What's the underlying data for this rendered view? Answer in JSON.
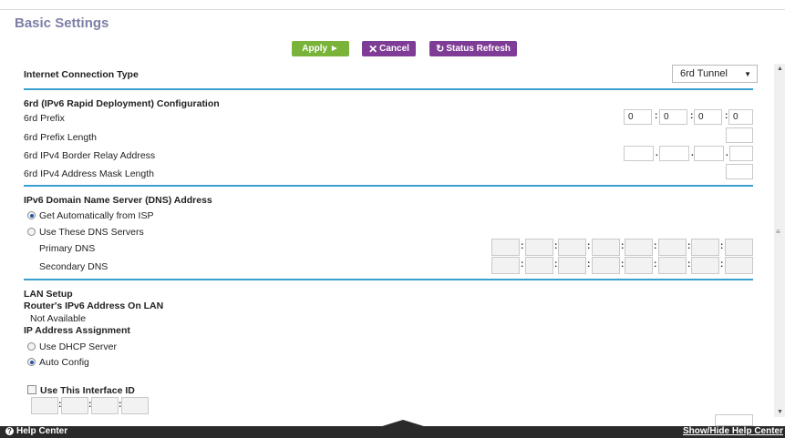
{
  "page": {
    "title": "Basic Settings"
  },
  "buttons": {
    "apply": "Apply ►",
    "cancel": "Cancel",
    "refresh": "Status Refresh"
  },
  "internet_connection_type": {
    "label": "Internet Connection Type",
    "selected": "6rd Tunnel"
  },
  "sixrd": {
    "heading": "6rd (IPv6 Rapid Deployment) Configuration",
    "prefix_label": "6rd Prefix",
    "prefix_values": [
      "0",
      "0",
      "0",
      "0"
    ],
    "prefix_length_label": "6rd Prefix Length",
    "relay_label": "6rd IPv4 Border Relay Address",
    "mask_label": "6rd IPv4 Address Mask Length"
  },
  "dns": {
    "heading": "IPv6 Domain Name Server (DNS) Address",
    "option_auto": "Get Automatically from ISP",
    "option_manual": "Use These DNS Servers",
    "primary_label": "Primary DNS",
    "secondary_label": "Secondary DNS"
  },
  "lan": {
    "heading": "LAN Setup",
    "router_addr_label": "Router's IPv6 Address On LAN",
    "router_addr_value": "Not Available",
    "ip_assign_label": "IP Address Assignment",
    "option_dhcp": "Use DHCP Server",
    "option_auto": "Auto Config",
    "interface_id_label": "Use This Interface ID"
  },
  "footer": {
    "help_center": "Help Center",
    "toggle": "Show/Hide Help Center"
  },
  "colors": {
    "accent_blue": "#3aa0d0",
    "apply_green": "#7ab33a",
    "purple": "#7e3c96",
    "title": "#7e7ea6"
  }
}
